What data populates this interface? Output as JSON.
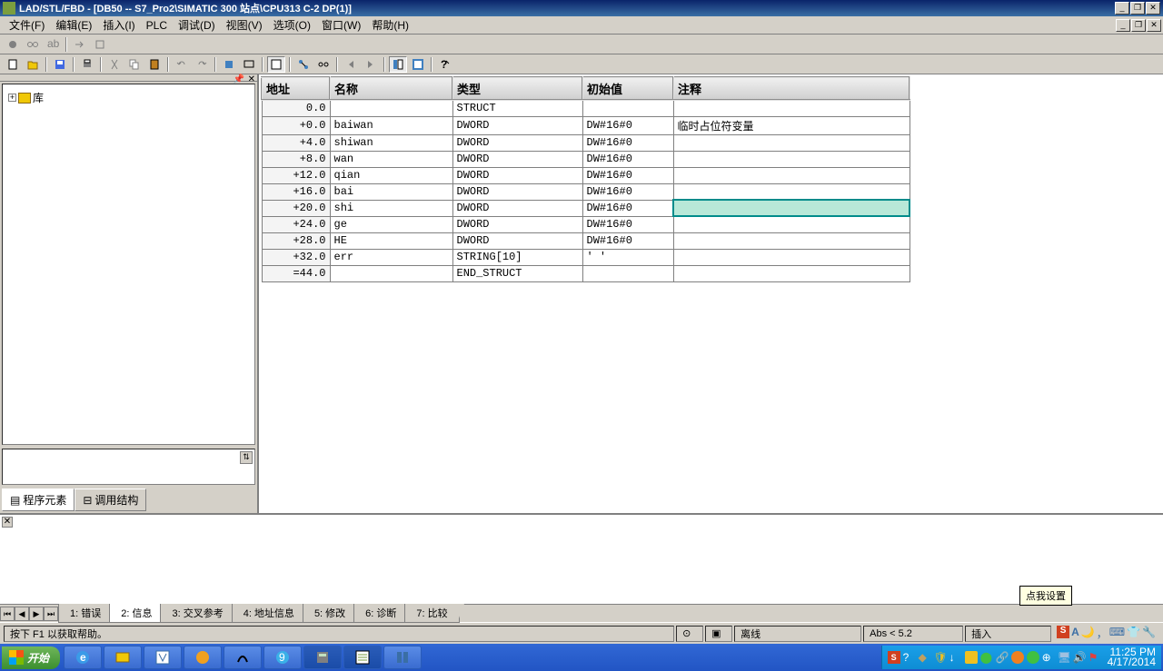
{
  "title": "LAD/STL/FBD  - [DB50 -- S7_Pro2\\SIMATIC 300 站点\\CPU313 C-2 DP(1)]",
  "menu": [
    "文件(F)",
    "编辑(E)",
    "插入(I)",
    "PLC",
    "调试(D)",
    "视图(V)",
    "选项(O)",
    "窗口(W)",
    "帮助(H)"
  ],
  "treeRoot": "库",
  "leftTabs": [
    "程序元素",
    "调用结构"
  ],
  "headers": {
    "addr": "地址",
    "name": "名称",
    "type": "类型",
    "init": "初始值",
    "comm": "注释"
  },
  "rows": [
    {
      "addr": "0.0",
      "name": "",
      "type": "STRUCT",
      "init": "",
      "comm": ""
    },
    {
      "addr": "+0.0",
      "name": "baiwan",
      "type": "DWORD",
      "init": "DW#16#0",
      "comm": "临时占位符变量"
    },
    {
      "addr": "+4.0",
      "name": "shiwan",
      "type": "DWORD",
      "init": "DW#16#0",
      "comm": ""
    },
    {
      "addr": "+8.0",
      "name": "wan",
      "type": "DWORD",
      "init": "DW#16#0",
      "comm": ""
    },
    {
      "addr": "+12.0",
      "name": "qian",
      "type": "DWORD",
      "init": "DW#16#0",
      "comm": ""
    },
    {
      "addr": "+16.0",
      "name": "bai",
      "type": "DWORD",
      "init": "DW#16#0",
      "comm": ""
    },
    {
      "addr": "+20.0",
      "name": "shi",
      "type": "DWORD",
      "init": "DW#16#0",
      "comm": "",
      "sel": true
    },
    {
      "addr": "+24.0",
      "name": "ge",
      "type": "DWORD",
      "init": "DW#16#0",
      "comm": ""
    },
    {
      "addr": "+28.0",
      "name": "HE",
      "type": "DWORD",
      "init": "DW#16#0",
      "comm": ""
    },
    {
      "addr": "+32.0",
      "name": "err",
      "type": "STRING[10]",
      "init": "' '",
      "comm": ""
    },
    {
      "addr": "=44.0",
      "name": "",
      "type": "END_STRUCT",
      "init": "",
      "comm": ""
    }
  ],
  "bottomTabs": [
    "1: 错误",
    "2: 信息",
    "3: 交叉参考",
    "4: 地址信息",
    "5: 修改",
    "6: 诊断",
    "7: 比较"
  ],
  "activeBottomTab": 1,
  "status": {
    "help": "按下 F1 以获取帮助。",
    "offline": "离线",
    "abs": "Abs < 5.2",
    "insert": "插入"
  },
  "helptip": "点我设置",
  "start": "开始",
  "clock": {
    "time": "11:25 PM",
    "date": "4/17/2014"
  }
}
